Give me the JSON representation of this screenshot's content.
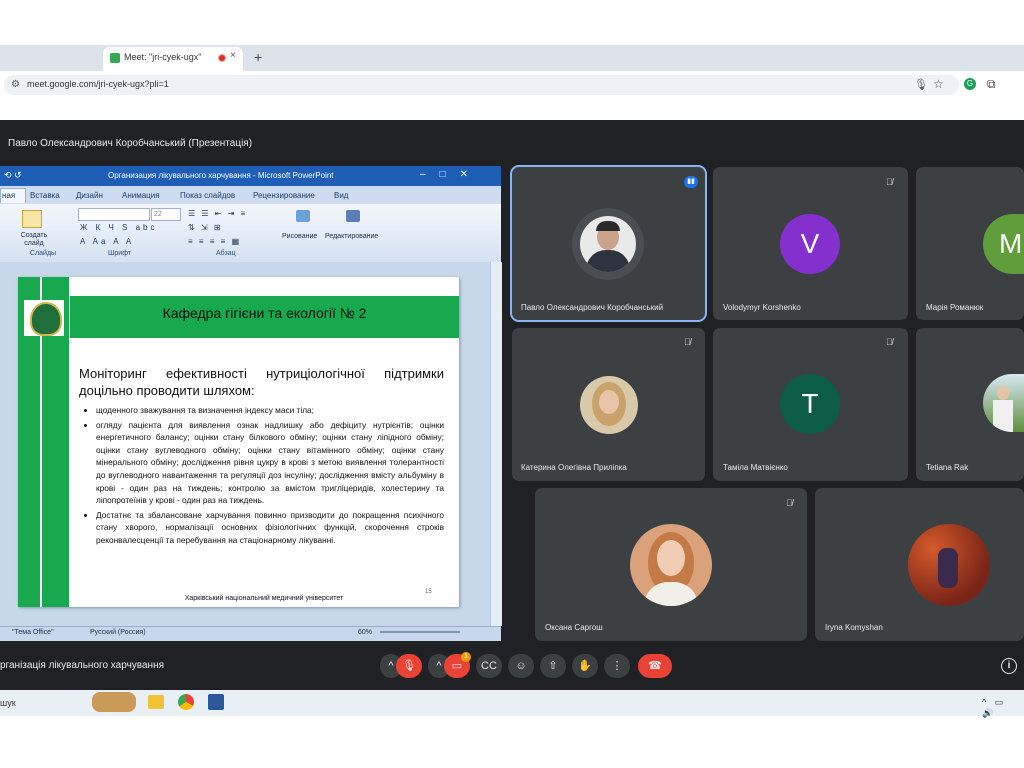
{
  "browser": {
    "tab_title": "Meet: \"jri-cyek-ugx\"",
    "tab_close": "×",
    "new_tab": "+",
    "url": "meet.google.com/jri-cyek-ugx?pli=1"
  },
  "meet": {
    "presentation_title": "Павло Олександрович Коробчанський (Презентація)",
    "meeting_name": "рганізація лікувального харчування",
    "notification_count": "1"
  },
  "powerpoint": {
    "window_title": "Организация лікувального харчування - Microsoft PowerPoint",
    "tabs": [
      "ная",
      "Вставка",
      "Дизайн",
      "Анимация",
      "Показ слайдов",
      "Рецензирование",
      "Вид"
    ],
    "ribbon": {
      "create_slide": "Создать слайд",
      "slides_group": "Слайды",
      "font_group": "Шрифт",
      "paragraph_group": "Абзац",
      "drawing": "Рисование",
      "editing": "Редактирование",
      "font_size": "22"
    },
    "status": {
      "theme": "\"Тема Office\"",
      "language": "Русский (Россия)",
      "zoom": "60%"
    },
    "slide": {
      "banner": "Кафедра гігієни та екології № 2",
      "heading": "Моніторинг ефективності нутриціологічної підтримки доцільно проводити шляхом:",
      "bullets": [
        "щоденного зважування та визначення індексу маси тіла;",
        "огляду пацієнта для виявлення ознак надлишку або дефіциту нутрієнтів; оцінки енергетичного балансу; оцінки стану білкового обміну; оцінки стану ліпідного обміну; оцінки стану вуглеводного обміну; оцінки стану вітамінного обміну; оцінки стану мінерального обміну; дослідження рівня цукру в крові з метою виявлення толерантності до вуглеводного навантаження та регуляції доз інсуліну; дослідження вмісту альбуміну в крові - один раз на тиждень; контролю за вмістом тригліцеридів, холестерину та ліпопротеїнів у крові - один раз на тиждень.",
        "Достатнє та збалансоване харчування повинно призводити до покращення психічного стану хворого, нормалізації основних фізіологічних функцій, скорочення строків реконвалесценції та перебування на стаціонарному лікуванні."
      ],
      "footer": "Харківський національний медичний університет",
      "page_number": "15"
    }
  },
  "participants": [
    {
      "name": "Павло Олександрович Коробчанський",
      "initial": "",
      "color": "#5f6368",
      "speaking": true
    },
    {
      "name": "Volodymyr Korshenko",
      "initial": "V",
      "color": "#8430ce"
    },
    {
      "name": "Марія Романюк",
      "initial": "M",
      "color": "#5f9e3a"
    },
    {
      "name": "Катерина Олегівна Приліпка",
      "initial": "",
      "color": "#c9a26b"
    },
    {
      "name": "Таміла Матвієнко",
      "initial": "T",
      "color": "#0d5c48"
    },
    {
      "name": "Tetiana Rak",
      "initial": "",
      "color": "#7aa35a"
    },
    {
      "name": "Оксана Саргош",
      "initial": "",
      "color": "#c98a5c"
    },
    {
      "name": "Iryna Komyshan",
      "initial": "",
      "color": "#a33b2c"
    }
  ],
  "taskbar": {
    "search": "шук"
  }
}
